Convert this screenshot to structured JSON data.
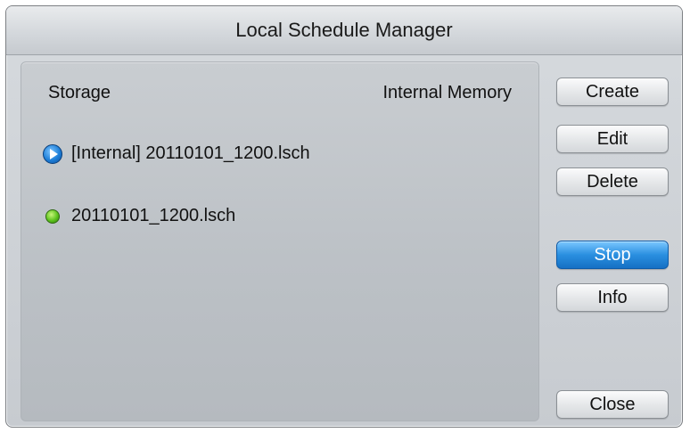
{
  "window": {
    "title": "Local Schedule Manager"
  },
  "storage": {
    "label": "Storage",
    "value": "Internal Memory"
  },
  "schedules": [
    {
      "name": "[Internal] 20110101_1200.lsch",
      "status_icon": "play-icon"
    },
    {
      "name": "20110101_1200.lsch",
      "status_icon": "green-dot-icon"
    }
  ],
  "buttons": {
    "create": "Create",
    "edit": "Edit",
    "delete": "Delete",
    "stop": "Stop",
    "info": "Info",
    "close": "Close"
  },
  "colors": {
    "accent": "#2a8fe0",
    "active_dot": "#5cc21d"
  }
}
